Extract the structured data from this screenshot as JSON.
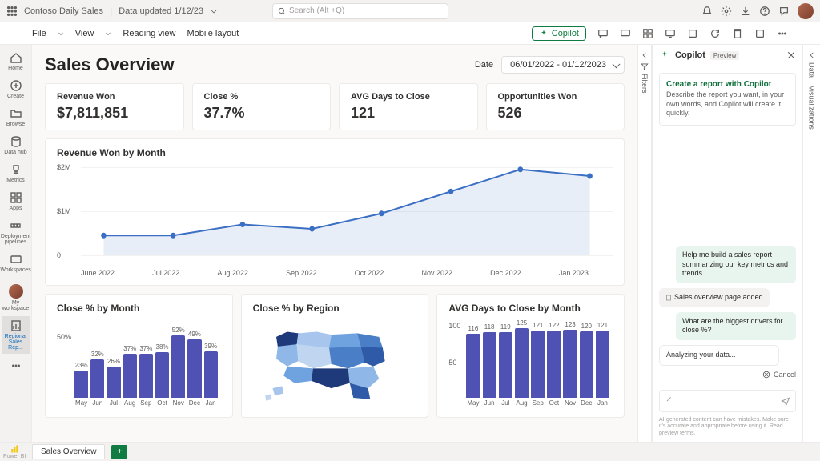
{
  "topbar": {
    "title": "Contoso Daily Sales",
    "subtitle": "Data updated 1/12/23",
    "search_placeholder": "Search (Alt +Q)"
  },
  "ribbon": {
    "file": "File",
    "view": "View",
    "reading_view": "Reading view",
    "mobile_layout": "Mobile layout",
    "copilot": "Copilot"
  },
  "leftnav": [
    {
      "name": "home",
      "label": "Home"
    },
    {
      "name": "create",
      "label": "Create"
    },
    {
      "name": "browse",
      "label": "Browse"
    },
    {
      "name": "data-hub",
      "label": "Data hub"
    },
    {
      "name": "metrics",
      "label": "Metrics"
    },
    {
      "name": "apps",
      "label": "Apps"
    },
    {
      "name": "pipelines",
      "label": "Deployment pipelines"
    },
    {
      "name": "workspaces",
      "label": "Workspaces"
    },
    {
      "name": "my-workspace",
      "label": "My workspace"
    },
    {
      "name": "regional",
      "label": "Regional Sales Rep..."
    }
  ],
  "header": {
    "title": "Sales Overview",
    "date_label": "Date",
    "date_range": "06/01/2022 - 01/12/2023"
  },
  "kpis": [
    {
      "label": "Revenue Won",
      "value": "$7,811,851"
    },
    {
      "label": "Close %",
      "value": "37.7%"
    },
    {
      "label": "AVG Days to Close",
      "value": "121"
    },
    {
      "label": "Opportunities Won",
      "value": "526"
    }
  ],
  "line_title": "Revenue Won by Month",
  "close_month_title": "Close % by Month",
  "close_region_title": "Close % by Region",
  "avg_days_title": "AVG Days to Close by Month",
  "filters_label": "Filters",
  "viz_label": "Visualizations",
  "data_label": "Data",
  "copilot": {
    "title": "Copilot",
    "preview": "Preview",
    "card_title": "Create a report with Copilot",
    "card_desc": "Describe the report you want, in your own words, and Copilot will create it quickly.",
    "msg1": "Help me build a sales report summarizing our key metrics and trends",
    "msg2": "Sales overview page added",
    "msg3": "What are the biggest drivers for close %?",
    "msg4": "Analyzing your data...",
    "cancel": "Cancel",
    "footer": "AI-generated content can have mistakes. Make sure it's accurate and appropriate before using it. Read preview terms."
  },
  "bottom": {
    "page_tab": "Sales Overview",
    "powerbi": "Power BI"
  },
  "chart_data": [
    {
      "type": "line",
      "title": "Revenue Won by Month",
      "x": [
        "June 2022",
        "Jul 2022",
        "Aug 2022",
        "Sep 2022",
        "Oct 2022",
        "Nov 2022",
        "Dec 2022",
        "Jan 2023"
      ],
      "values_m": [
        0.45,
        0.45,
        0.7,
        0.6,
        0.95,
        1.45,
        1.95,
        1.8
      ],
      "ylim": [
        0,
        2
      ],
      "yticks": [
        "0",
        "$1M",
        "$2M"
      ],
      "ylabel": "",
      "xlabel": ""
    },
    {
      "type": "bar",
      "title": "Close % by Month",
      "categories": [
        "May",
        "Jun",
        "Jul",
        "Aug",
        "Sep",
        "Oct",
        "Nov",
        "Dec",
        "Jan"
      ],
      "values": [
        23,
        32,
        26,
        37,
        37,
        38,
        52,
        49,
        39
      ],
      "ylim": [
        0,
        60
      ],
      "yticks": [
        "50%"
      ],
      "ylabel": "",
      "xlabel": ""
    },
    {
      "type": "choropleth",
      "title": "Close % by Region",
      "note": "US states, darker = higher close %"
    },
    {
      "type": "bar",
      "title": "AVG Days to Close by Month",
      "categories": [
        "May",
        "Jun",
        "Jul",
        "Aug",
        "Sep",
        "Oct",
        "Nov",
        "Dec",
        "Jan"
      ],
      "values": [
        116,
        118,
        119,
        125,
        121,
        122,
        123,
        120,
        121
      ],
      "ylim": [
        0,
        130
      ],
      "yticks": [
        "50",
        "100"
      ],
      "ylabel": "",
      "xlabel": ""
    }
  ]
}
